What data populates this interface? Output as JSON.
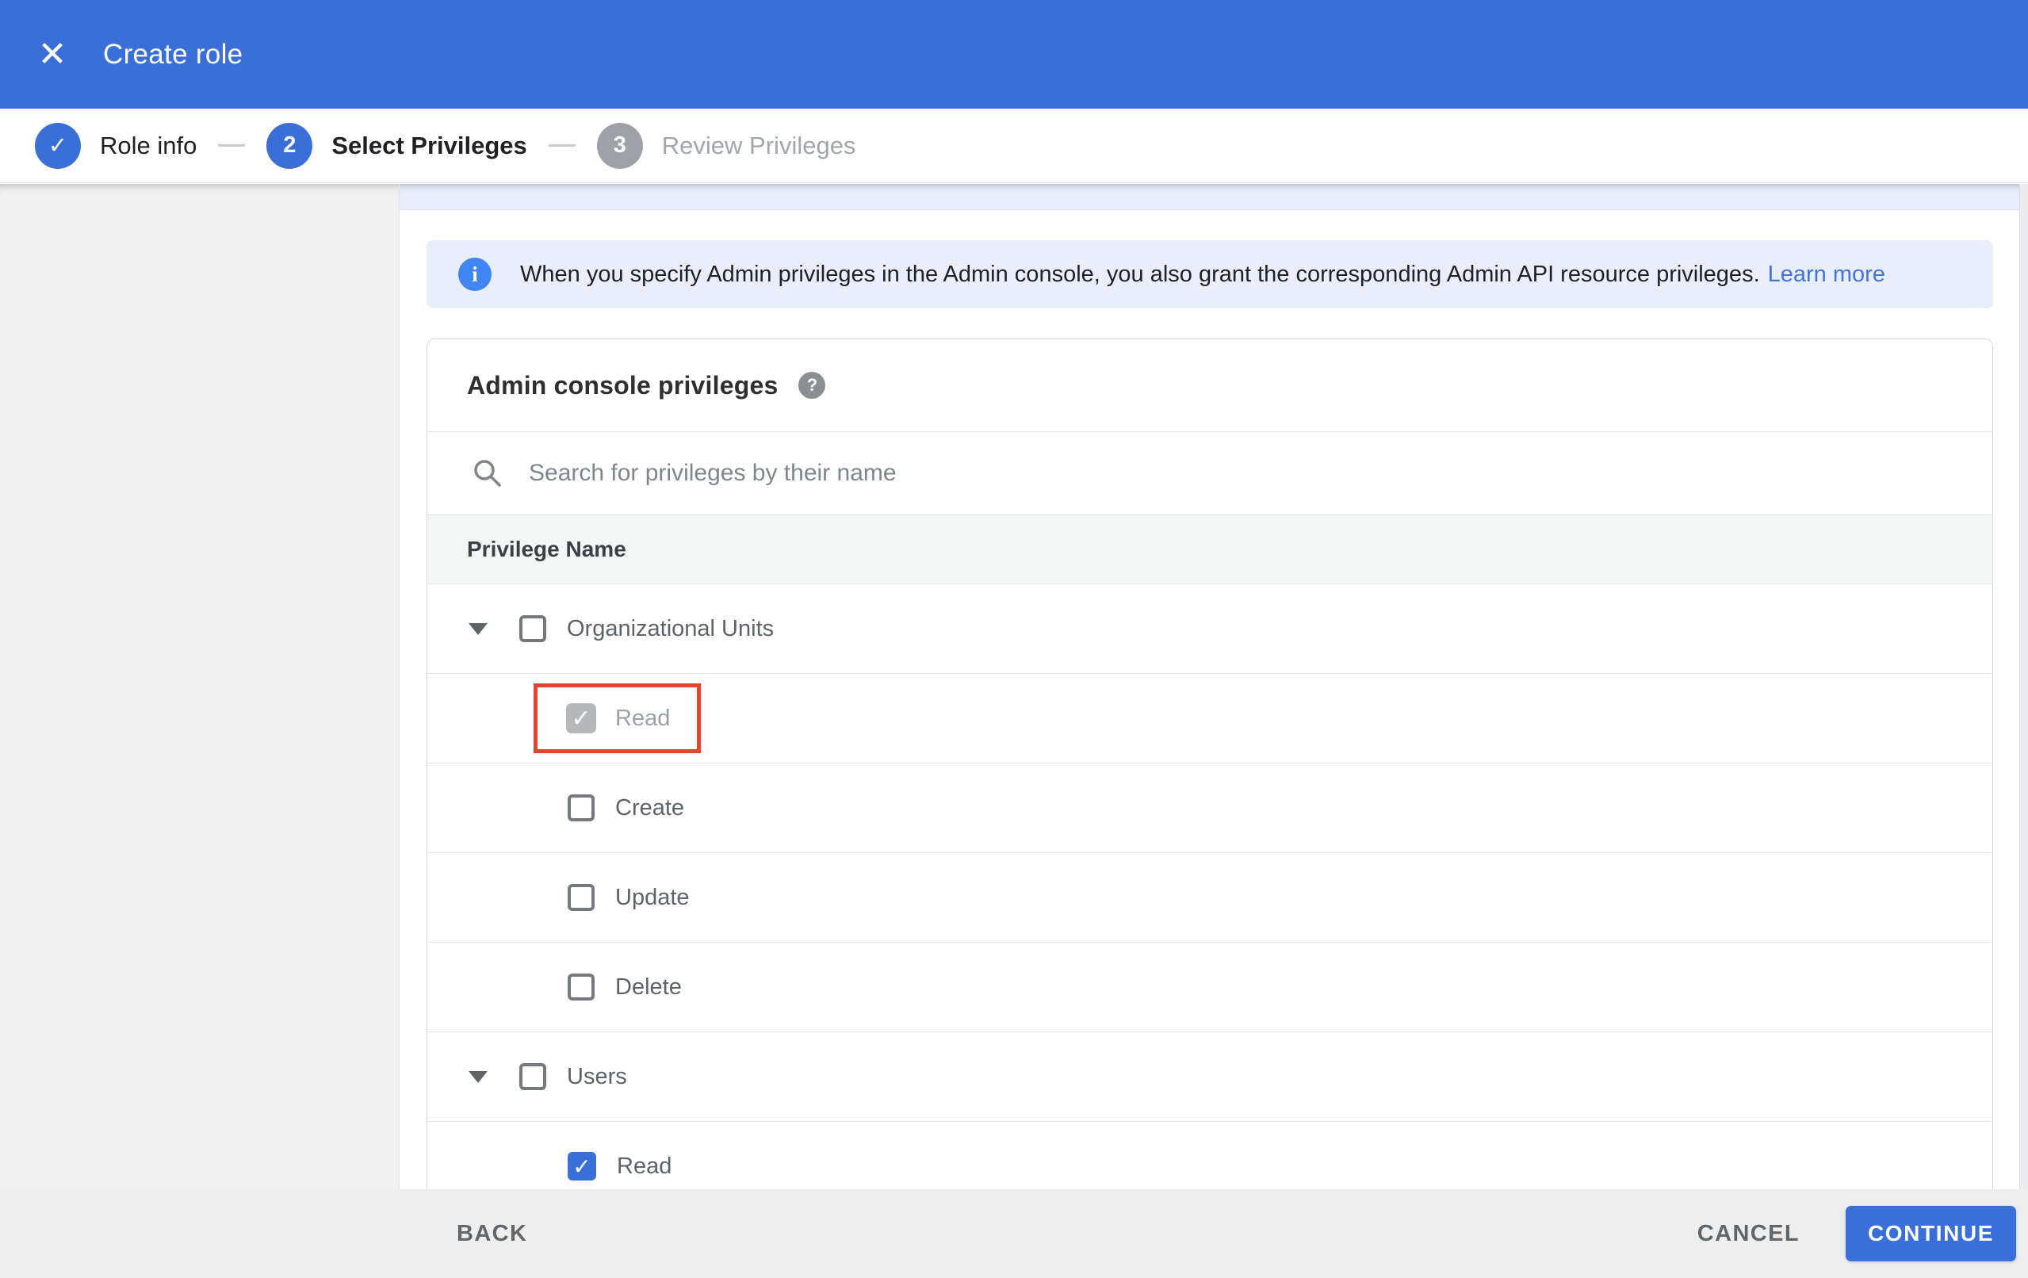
{
  "appbar": {
    "title": "Create role",
    "close_glyph": "✕"
  },
  "stepper": {
    "steps": [
      {
        "label": "Role info",
        "indicator": "✓",
        "state": "done"
      },
      {
        "label": "Select Privileges",
        "indicator": "2",
        "state": "active"
      },
      {
        "label": "Review Privileges",
        "indicator": "3",
        "state": "todo"
      }
    ]
  },
  "banner": {
    "icon_glyph": "i",
    "text": "When you specify Admin privileges in the Admin console, you also grant the corresponding Admin API resource privileges.",
    "link_label": "Learn more"
  },
  "card": {
    "title": "Admin console privileges",
    "help_glyph": "?",
    "search_placeholder": "Search for privileges by their name",
    "table_header": "Privilege Name",
    "rows": [
      {
        "label": "Organizational Units",
        "type": "parent",
        "expanded": true,
        "checked": false
      },
      {
        "label": "Read",
        "type": "child",
        "checked": true,
        "disabled": true,
        "highlighted": true
      },
      {
        "label": "Create",
        "type": "child",
        "checked": false
      },
      {
        "label": "Update",
        "type": "child",
        "checked": false
      },
      {
        "label": "Delete",
        "type": "child",
        "checked": false
      },
      {
        "label": "Users",
        "type": "parent",
        "expanded": true,
        "checked": false
      },
      {
        "label": "Read",
        "type": "child",
        "checked": true,
        "checked_style": "blue",
        "clipped": true
      }
    ],
    "check_glyph": "✓"
  },
  "footer": {
    "back_label": "BACK",
    "cancel_label": "CANCEL",
    "continue_label": "CONTINUE"
  },
  "colors": {
    "brand_blue": "#3b6fd8",
    "info_icon_blue": "#4285f4",
    "link_blue": "#4374d9",
    "highlight_red": "#e8432c",
    "banner_bg": "#e8eefb",
    "sidebar_gray": "#f0f0f0",
    "footer_gray": "#eeeeee"
  }
}
